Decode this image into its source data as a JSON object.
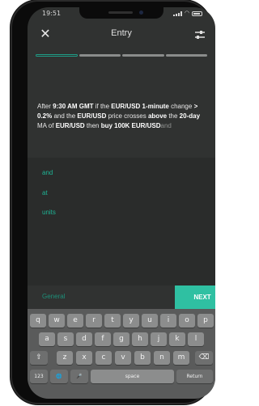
{
  "status_bar": {
    "time": "19:51"
  },
  "header": {
    "title": "Entry",
    "close_glyph": "✕",
    "settings_icon": "sliders-icon"
  },
  "progress": {
    "steps": 4,
    "current": 1
  },
  "instruction": {
    "parts": [
      {
        "t": "After ",
        "b": false
      },
      {
        "t": "9:30 AM GMT",
        "b": true
      },
      {
        "t": " if the ",
        "b": false
      },
      {
        "t": "EUR/USD 1-minute",
        "b": true
      },
      {
        "t": " change ",
        "b": false
      },
      {
        "t": "> 0.2%",
        "b": true
      },
      {
        "t": " and the ",
        "b": false
      },
      {
        "t": "EUR/USD",
        "b": true
      },
      {
        "t": " price crosses ",
        "b": false
      },
      {
        "t": "above",
        "b": true
      },
      {
        "t": " the ",
        "b": false
      },
      {
        "t": "20-day",
        "b": true
      },
      {
        "t": " MA of ",
        "b": false
      },
      {
        "t": "EUR/USD",
        "b": true
      },
      {
        "t": " then ",
        "b": false
      },
      {
        "t": "buy 100K EUR/USD",
        "b": true
      }
    ],
    "hint": "and"
  },
  "suggestions": [
    "and",
    "at",
    "units"
  ],
  "footer": {
    "category": "General",
    "next_label": "NEXT"
  },
  "keyboard": {
    "row1": [
      "q",
      "w",
      "e",
      "r",
      "t",
      "y",
      "u",
      "i",
      "o",
      "p"
    ],
    "row2": [
      "a",
      "s",
      "d",
      "f",
      "g",
      "h",
      "j",
      "k",
      "l"
    ],
    "row3": [
      "z",
      "x",
      "c",
      "v",
      "b",
      "n",
      "m"
    ],
    "shift": "⇧",
    "backspace": "⌫",
    "numbers": "123",
    "globe": "🌐",
    "mic": "🎤",
    "space": "space",
    "return": "Return"
  },
  "colors": {
    "accent": "#2fc0a2",
    "suggestion": "#1eb394",
    "background": "#303231"
  }
}
